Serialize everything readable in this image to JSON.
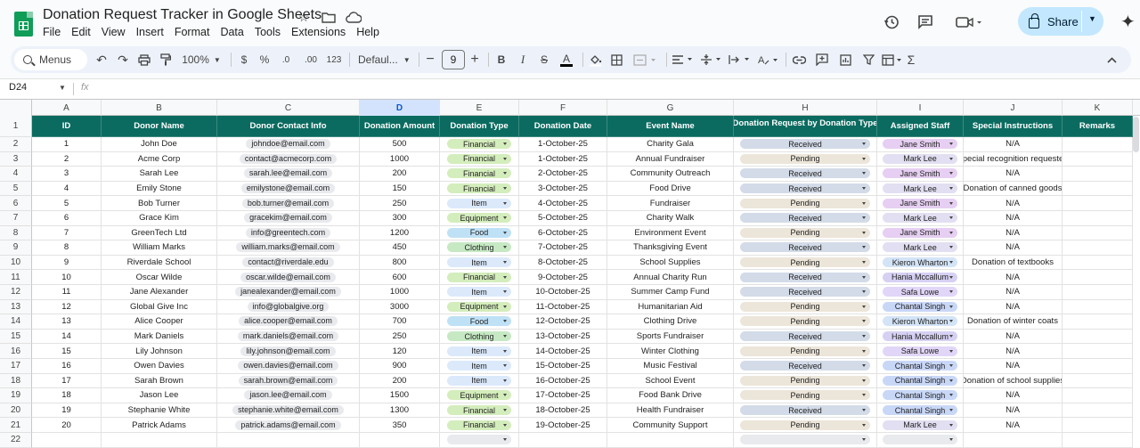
{
  "app": {
    "title": "Donation Request Tracker in Google Sheets",
    "menu": [
      "File",
      "Edit",
      "View",
      "Insert",
      "Format",
      "Data",
      "Tools",
      "Extensions",
      "Help"
    ],
    "share_label": "Share"
  },
  "toolbar": {
    "menus_label": "Menus",
    "zoom": "100%",
    "currency": "$",
    "percent": "%",
    "dec_decrease": ".0",
    "dec_increase": ".00",
    "number_format": "123",
    "font": "Defaul...",
    "font_size": "9"
  },
  "formula_bar": {
    "cell_ref": "D24",
    "fx": "fx",
    "value": ""
  },
  "sheet": {
    "column_letters": [
      "A",
      "B",
      "C",
      "D",
      "E",
      "F",
      "G",
      "H",
      "I",
      "J",
      "K"
    ],
    "selected_column": "D",
    "headers": [
      "ID",
      "Donor Name",
      "Donor Contact Info",
      "Donation Amount",
      "Donation Type",
      "Donation Date",
      "Event Name",
      "Donation Request by Donation Type",
      "Assigned Staff",
      "Special Instructions",
      "Remarks"
    ],
    "header_row_number": "1",
    "rows": [
      {
        "row": "2",
        "id": "1",
        "name": "John Doe",
        "email": "johndoe@email.com",
        "amount": "500",
        "type": "Financial",
        "date": "1-October-25",
        "event": "Charity Gala",
        "status": "Received",
        "staff": "Jane Smith",
        "notes": "N/A",
        "remarks": ""
      },
      {
        "row": "3",
        "id": "2",
        "name": "Acme Corp",
        "email": "contact@acmecorp.com",
        "amount": "1000",
        "type": "Financial",
        "date": "1-October-25",
        "event": "Annual Fundraiser",
        "status": "Pending",
        "staff": "Mark Lee",
        "notes": "Special recognition requested",
        "remarks": ""
      },
      {
        "row": "4",
        "id": "3",
        "name": "Sarah Lee",
        "email": "sarah.lee@email.com",
        "amount": "200",
        "type": "Financial",
        "date": "2-October-25",
        "event": "Community Outreach",
        "status": "Received",
        "staff": "Jane Smith",
        "notes": "N/A",
        "remarks": ""
      },
      {
        "row": "5",
        "id": "4",
        "name": "Emily Stone",
        "email": "emilystone@email.com",
        "amount": "150",
        "type": "Financial",
        "date": "3-October-25",
        "event": "Food Drive",
        "status": "Received",
        "staff": "Mark Lee",
        "notes": "Donation of canned goods",
        "remarks": ""
      },
      {
        "row": "6",
        "id": "5",
        "name": "Bob Turner",
        "email": "bob.turner@email.com",
        "amount": "250",
        "type": "Item",
        "date": "4-October-25",
        "event": "Fundraiser",
        "status": "Pending",
        "staff": "Jane Smith",
        "notes": "N/A",
        "remarks": ""
      },
      {
        "row": "7",
        "id": "6",
        "name": "Grace Kim",
        "email": "gracekim@email.com",
        "amount": "300",
        "type": "Equipment",
        "date": "5-October-25",
        "event": "Charity Walk",
        "status": "Received",
        "staff": "Mark Lee",
        "notes": "N/A",
        "remarks": ""
      },
      {
        "row": "8",
        "id": "7",
        "name": "GreenTech Ltd",
        "email": "info@greentech.com",
        "amount": "1200",
        "type": "Food",
        "date": "6-October-25",
        "event": "Environment Event",
        "status": "Pending",
        "staff": "Jane Smith",
        "notes": "N/A",
        "remarks": ""
      },
      {
        "row": "9",
        "id": "8",
        "name": "William Marks",
        "email": "william.marks@email.com",
        "amount": "450",
        "type": "Clothing",
        "date": "7-October-25",
        "event": "Thanksgiving Event",
        "status": "Received",
        "staff": "Mark Lee",
        "notes": "N/A",
        "remarks": ""
      },
      {
        "row": "10",
        "id": "9",
        "name": "Riverdale School",
        "email": "contact@riverdale.edu",
        "amount": "800",
        "type": "Item",
        "date": "8-October-25",
        "event": "School Supplies",
        "status": "Pending",
        "staff": "Kieron Wharton",
        "notes": "Donation of textbooks",
        "remarks": ""
      },
      {
        "row": "11",
        "id": "10",
        "name": "Oscar Wilde",
        "email": "oscar.wilde@email.com",
        "amount": "600",
        "type": "Financial",
        "date": "9-October-25",
        "event": "Annual Charity Run",
        "status": "Received",
        "staff": "Hania Mccallum",
        "notes": "N/A",
        "remarks": ""
      },
      {
        "row": "12",
        "id": "11",
        "name": "Jane Alexander",
        "email": "janealexander@email.com",
        "amount": "1000",
        "type": "Item",
        "date": "10-October-25",
        "event": "Summer Camp Fund",
        "status": "Received",
        "staff": "Safa Lowe",
        "notes": "N/A",
        "remarks": ""
      },
      {
        "row": "13",
        "id": "12",
        "name": "Global Give Inc",
        "email": "info@globalgive.org",
        "amount": "3000",
        "type": "Equipment",
        "date": "11-October-25",
        "event": "Humanitarian Aid",
        "status": "Pending",
        "staff": "Chantal Singh",
        "notes": "N/A",
        "remarks": ""
      },
      {
        "row": "14",
        "id": "13",
        "name": "Alice Cooper",
        "email": "alice.cooper@email.com",
        "amount": "700",
        "type": "Food",
        "date": "12-October-25",
        "event": "Clothing Drive",
        "status": "Pending",
        "staff": "Kieron Wharton",
        "notes": "Donation of winter coats",
        "remarks": ""
      },
      {
        "row": "15",
        "id": "14",
        "name": "Mark Daniels",
        "email": "mark.daniels@email.com",
        "amount": "250",
        "type": "Clothing",
        "date": "13-October-25",
        "event": "Sports Fundraiser",
        "status": "Received",
        "staff": "Hania Mccallum",
        "notes": "N/A",
        "remarks": ""
      },
      {
        "row": "16",
        "id": "15",
        "name": "Lily Johnson",
        "email": "lily.johnson@email.com",
        "amount": "120",
        "type": "Item",
        "date": "14-October-25",
        "event": "Winter Clothing",
        "status": "Pending",
        "staff": "Safa Lowe",
        "notes": "N/A",
        "remarks": ""
      },
      {
        "row": "17",
        "id": "16",
        "name": "Owen Davies",
        "email": "owen.davies@email.com",
        "amount": "900",
        "type": "Item",
        "date": "15-October-25",
        "event": "Music Festival",
        "status": "Received",
        "staff": "Chantal Singh",
        "notes": "N/A",
        "remarks": ""
      },
      {
        "row": "18",
        "id": "17",
        "name": "Sarah Brown",
        "email": "sarah.brown@email.com",
        "amount": "200",
        "type": "Item",
        "date": "16-October-25",
        "event": "School Event",
        "status": "Pending",
        "staff": "Chantal Singh",
        "notes": "Donation of school supplies",
        "remarks": ""
      },
      {
        "row": "19",
        "id": "18",
        "name": "Jason Lee",
        "email": "jason.lee@email.com",
        "amount": "1500",
        "type": "Equipment",
        "date": "17-October-25",
        "event": "Food Bank Drive",
        "status": "Pending",
        "staff": "Chantal Singh",
        "notes": "N/A",
        "remarks": ""
      },
      {
        "row": "20",
        "id": "19",
        "name": "Stephanie White",
        "email": "stephanie.white@email.com",
        "amount": "1300",
        "type": "Financial",
        "date": "18-October-25",
        "event": "Health Fundraiser",
        "status": "Received",
        "staff": "Chantal Singh",
        "notes": "N/A",
        "remarks": ""
      },
      {
        "row": "21",
        "id": "20",
        "name": "Patrick Adams",
        "email": "patrick.adams@email.com",
        "amount": "350",
        "type": "Financial",
        "date": "19-October-25",
        "event": "Community Support",
        "status": "Pending",
        "staff": "Mark Lee",
        "notes": "N/A",
        "remarks": ""
      }
    ],
    "empty_row_number": "22"
  },
  "colors": {
    "header_bg": "#0b6b60",
    "type_financial": "#d4edbc",
    "type_item": "#dbe9fb",
    "type_equipment": "#d4edbc",
    "type_food": "#bfe1f6",
    "type_clothing": "#c6e9c4",
    "status_received": "#d3dbe8",
    "status_pending": "#ece5d9",
    "staff_jane": "#e6cff2",
    "staff_mark": "#e2dff2",
    "staff_kieron": "#d4e4f7",
    "staff_hania": "#d6d1f3",
    "staff_safa": "#e1d6f7",
    "staff_chantal": "#c9d7f7"
  }
}
